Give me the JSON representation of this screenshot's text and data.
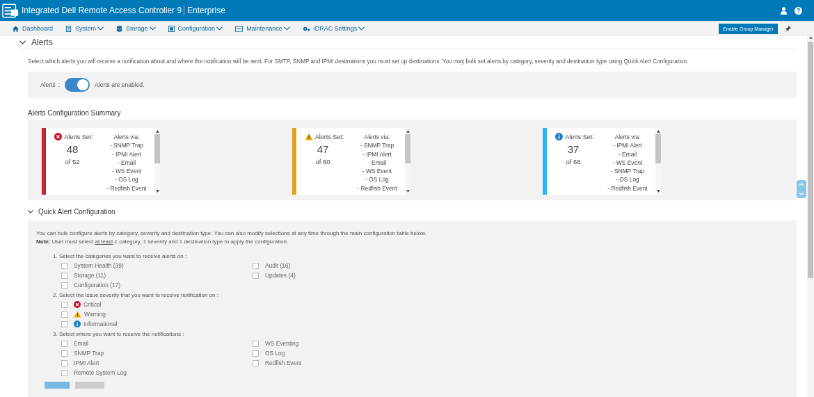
{
  "header": {
    "title": "Integrated Dell Remote Access Controller 9",
    "edition": "Enterprise"
  },
  "nav": {
    "items": [
      {
        "label": "Dashboard",
        "kind": "home",
        "caret": false
      },
      {
        "label": "System",
        "kind": "server",
        "caret": true
      },
      {
        "label": "Storage",
        "kind": "database",
        "caret": true
      },
      {
        "label": "Configuration",
        "kind": "config",
        "caret": true
      },
      {
        "label": "Maintenance",
        "kind": "maint",
        "caret": true
      },
      {
        "label": "iDRAC Settings",
        "kind": "gears",
        "caret": true
      }
    ],
    "button": "Enable Group Manager"
  },
  "alerts": {
    "title": "Alerts",
    "expanded": true,
    "description": "Select which alerts you will receive a notification about and where the notification will be sent. For SMTP, SNMP and IPMI destinations you must set up destinations. You may bulk set alerts by category, severity and destination type using Quick Alert Configuration.",
    "toggle": {
      "label": "Alerts",
      "separator": ":",
      "on": true,
      "status": "Alerts are enabled."
    }
  },
  "summary": {
    "title": "Alerts Configuration Summary",
    "cards": [
      {
        "kind": "critical",
        "color": "#c1272d",
        "label": "Alerts Set:",
        "count": "48",
        "total": "of 52",
        "via_title": "Alerts via:",
        "via": [
          "- SNMP Trap",
          "- IPMI Alert",
          "- Email",
          "- WS Event",
          "- OS Log",
          "- Redfish Event"
        ]
      },
      {
        "kind": "warning",
        "color": "#e3a21a",
        "label": "Alerts Set:",
        "count": "47",
        "total": "of 60",
        "via_title": "Alerts via:",
        "via": [
          "- SNMP Trap",
          "- IPMI Alert",
          "- Email",
          "- WS Event",
          "- OS Log",
          "- Redfish Event"
        ]
      },
      {
        "kind": "info",
        "color": "#2fb5ee",
        "label": "Alerts Set:",
        "count": "37",
        "total": "of 68",
        "via_title": "Alerts via:",
        "via": [
          "- IPMI Alert",
          "- Email",
          "- WS Event",
          "- SNMP Trap",
          "- OS Log",
          "- Redfish Event"
        ]
      }
    ]
  },
  "quick": {
    "title": "Quick Alert Configuration",
    "expanded": true,
    "intro": "You can bulk configure alerts by category, severity and destination type. You can also modify selections at any time through the main configuration table below.",
    "note": {
      "label": "Note:",
      "before": "User must select ",
      "underlined": "at least",
      "after": " 1 category, 1 severity and 1 destination type to apply the configuration."
    },
    "steps": [
      {
        "title": "1. Select the categories you want to receive alerts on :",
        "columns": [
          [
            {
              "label": "System Health (39)",
              "checked": false
            },
            {
              "label": "Storage (11)",
              "checked": false
            },
            {
              "label": "Configuration (17)",
              "checked": false
            }
          ],
          [
            {
              "label": "Audit (16)",
              "checked": false
            },
            {
              "label": "Updates (4)",
              "checked": false
            }
          ]
        ]
      },
      {
        "title": "2. Select the issue severity that you want to receive notification on :",
        "columns": [
          [
            {
              "label": "Critical",
              "checked": false,
              "kind": "critical"
            },
            {
              "label": "Warning",
              "checked": false,
              "kind": "warning"
            },
            {
              "label": "Informational",
              "checked": false,
              "kind": "info"
            }
          ]
        ]
      },
      {
        "title": "3. Select where you want to receive the notifications :",
        "columns": [
          [
            {
              "label": "Email",
              "checked": false
            },
            {
              "label": "SNMP Trap",
              "checked": false
            },
            {
              "label": "IPMI Alert",
              "checked": false
            },
            {
              "label": "Remote System Log",
              "checked": false
            }
          ],
          [
            {
              "label": "WS Eventing",
              "checked": false
            },
            {
              "label": "OS Log",
              "checked": false
            },
            {
              "label": "Redfish Event",
              "checked": false
            }
          ]
        ]
      }
    ]
  }
}
